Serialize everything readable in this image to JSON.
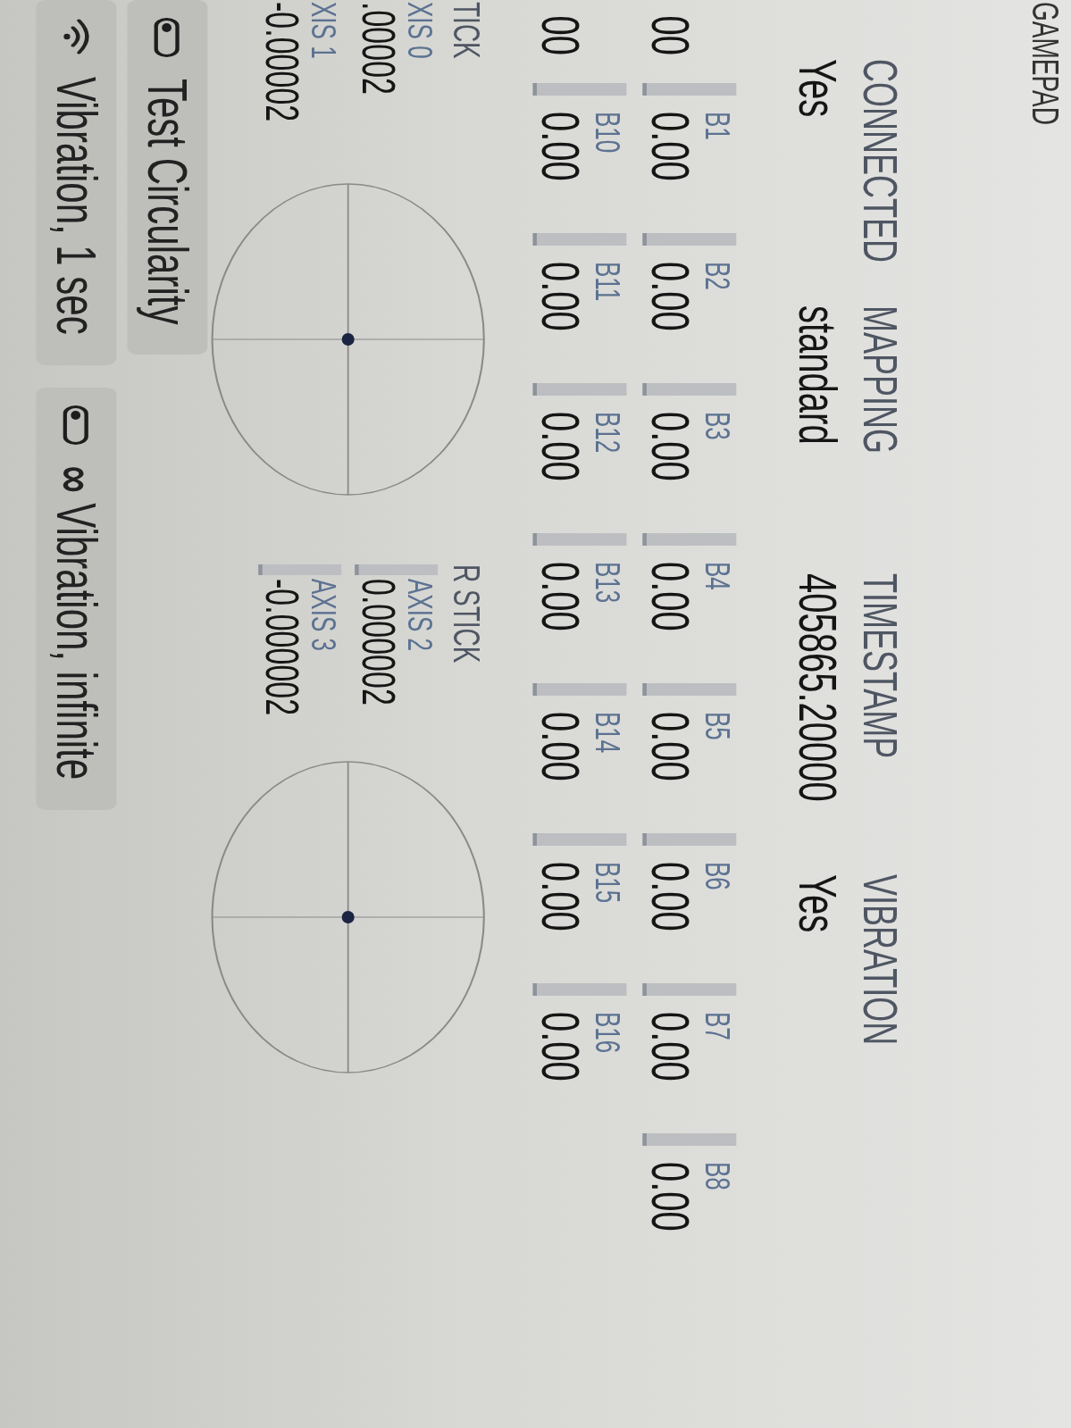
{
  "header": {
    "title": "GAMEPAD"
  },
  "status": [
    {
      "caption": "CONNECTED",
      "value": "Yes"
    },
    {
      "caption": "MAPPING",
      "value": "standard"
    },
    {
      "caption": "TIMESTAMP",
      "value": "405865.20000"
    },
    {
      "caption": "VIBRATION",
      "value": "Yes"
    }
  ],
  "buttons": [
    {
      "value": "00"
    },
    {
      "caption": "B1",
      "value": "0.00",
      "level": 0
    },
    {
      "caption": "B2",
      "value": "0.00",
      "level": 0
    },
    {
      "caption": "B3",
      "value": "0.00",
      "level": 0
    },
    {
      "caption": "B4",
      "value": "0.00",
      "level": 0
    },
    {
      "caption": "B5",
      "value": "0.00",
      "level": 0
    },
    {
      "caption": "B6",
      "value": "0.00",
      "level": 0
    },
    {
      "caption": "B7",
      "value": "0.00",
      "level": 0
    },
    {
      "caption": "B8",
      "value": "0.00",
      "level": 0
    },
    {
      "value": "00"
    },
    {
      "caption": "B10",
      "value": "0.00",
      "level": 0
    },
    {
      "caption": "B11",
      "value": "0.00",
      "level": 0
    },
    {
      "caption": "B12",
      "value": "0.00",
      "level": 0
    },
    {
      "caption": "B13",
      "value": "0.00",
      "level": 0
    },
    {
      "caption": "B14",
      "value": "0.00",
      "level": 0
    },
    {
      "caption": "B15",
      "value": "0.00",
      "level": 0
    },
    {
      "caption": "B16",
      "value": "0.00",
      "level": 0
    }
  ],
  "sticks": [
    {
      "title": "TICK",
      "axes": [
        {
          "caption": "XIS 0",
          "value": ".00002"
        },
        {
          "caption": "XIS 1",
          "value": "-0.00002"
        }
      ]
    },
    {
      "title": "R STICK",
      "axes": [
        {
          "caption": "AXIS 2",
          "value": "0.000002",
          "level": 0
        },
        {
          "caption": "AXIS 3",
          "value": "-0.000002",
          "level": 0
        }
      ]
    }
  ],
  "actions": [
    [
      {
        "kind": "toggle",
        "label": "Test Circularity",
        "on": false
      }
    ],
    [
      {
        "kind": "pulse",
        "label": "Vibration, 1 sec"
      },
      {
        "kind": "toggle",
        "label": "**∞** Vibration, infinite",
        "on": false
      }
    ]
  ]
}
